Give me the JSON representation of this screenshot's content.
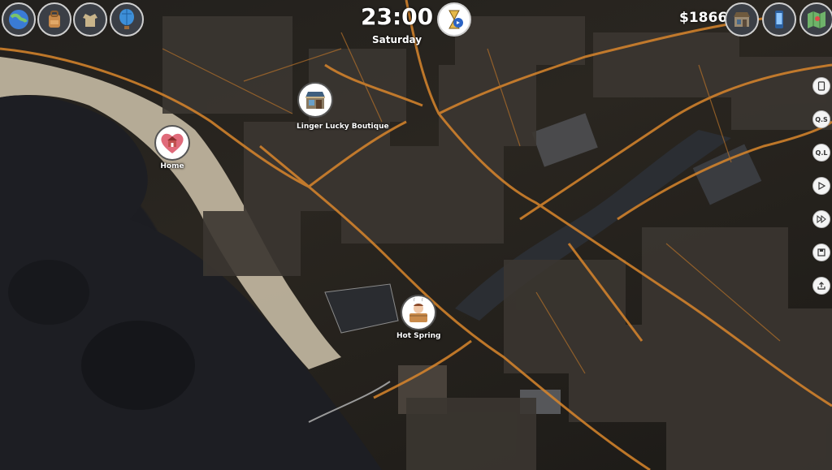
{
  "hud": {
    "time": "23:00",
    "day": "Saturday",
    "money": "$1866"
  },
  "top_left_icons": [
    "globe-icon",
    "backpack-icon",
    "wardrobe-icon",
    "hot-air-balloon-icon"
  ],
  "top_right_icons": [
    "shop-icon",
    "phone-icon",
    "map-icon"
  ],
  "side_buttons": [
    {
      "name": "journal-button",
      "label": ""
    },
    {
      "name": "quick-save-button",
      "label": "Q.S"
    },
    {
      "name": "quick-load-button",
      "label": "Q.L"
    },
    {
      "name": "play-button",
      "label": ""
    },
    {
      "name": "fast-forward-button",
      "label": ""
    },
    {
      "name": "save-button",
      "label": ""
    },
    {
      "name": "export-button",
      "label": ""
    }
  ],
  "locations": {
    "home": "Home",
    "boutique": "Linger Lucky Boutique",
    "hot_spring": "Hot Spring"
  },
  "colors": {
    "road_light": "#e08a2a",
    "sea": "#1c1d22",
    "beach": "#d8cdb8"
  }
}
